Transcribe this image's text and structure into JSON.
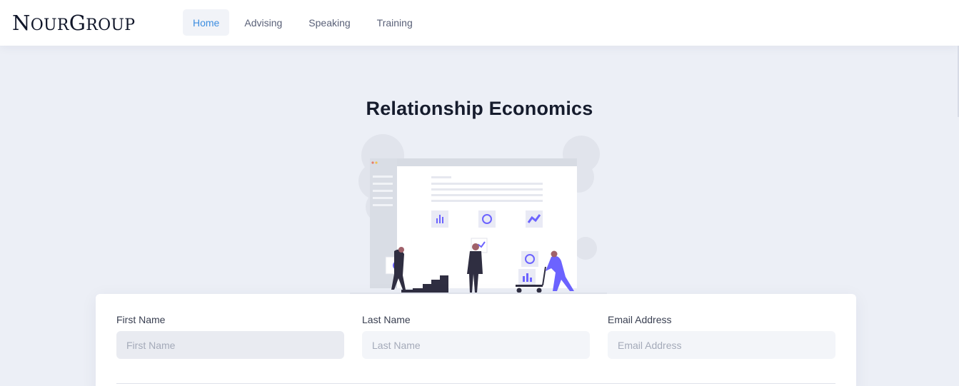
{
  "brand": {
    "logo_text_a": "N",
    "logo_text_b": "OUR",
    "logo_text_c": "G",
    "logo_text_d": "ROUP"
  },
  "nav": {
    "items": [
      {
        "label": "Home",
        "active": true
      },
      {
        "label": "Advising",
        "active": false
      },
      {
        "label": "Speaking",
        "active": false
      },
      {
        "label": "Training",
        "active": false
      }
    ]
  },
  "hero": {
    "title": "Relationship Economics"
  },
  "form": {
    "first_name": {
      "label": "First Name",
      "placeholder": "First Name",
      "value": ""
    },
    "last_name": {
      "label": "Last Name",
      "placeholder": "Last Name",
      "value": ""
    },
    "email": {
      "label": "Email Address",
      "placeholder": "Email Address",
      "value": ""
    }
  },
  "colors": {
    "accent": "#3d8ee0",
    "illustration_purple": "#6c63ff",
    "background": "#eceff6"
  }
}
